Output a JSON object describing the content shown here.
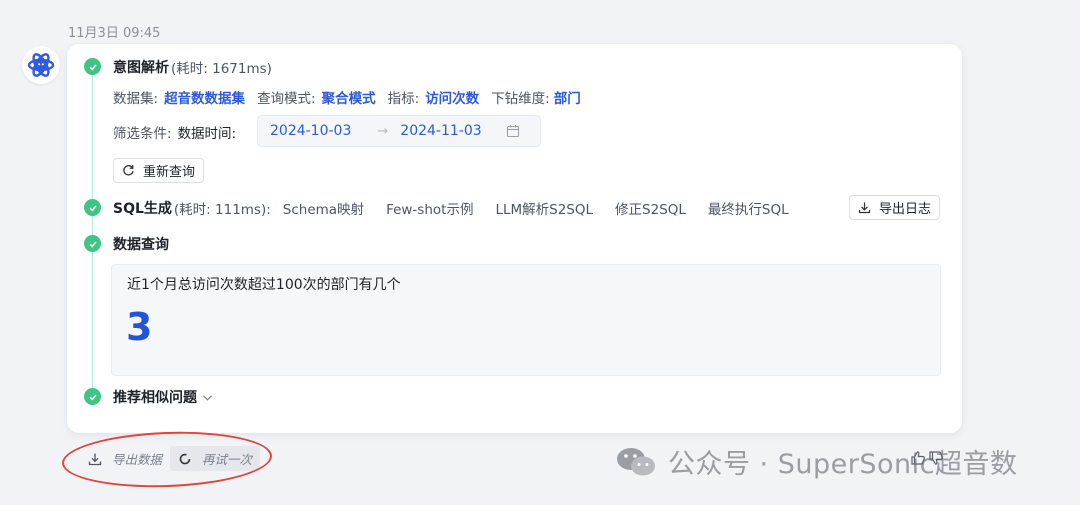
{
  "timestamp": "11月3日 09:45",
  "steps": {
    "intent": {
      "title": "意图解析",
      "elapsed": "(耗时: 1671ms)",
      "dataset_label": "数据集:",
      "dataset_value": "超音数数据集",
      "query_mode_label": "查询模式:",
      "query_mode_value": "聚合模式",
      "metric_label": "指标:",
      "metric_value": "访问次数",
      "drill_label": "下钻维度:",
      "drill_value": "部门",
      "filter_label": "筛选条件:",
      "date_label": "数据时间:",
      "date_start": "2024-10-03",
      "date_arrow": "→",
      "date_end": "2024-11-03",
      "requery_label": "重新查询"
    },
    "sql": {
      "title": "SQL生成",
      "elapsed": "(耗时: 111ms):",
      "items": [
        "Schema映射",
        "Few-shot示例",
        "LLM解析S2SQL",
        "修正S2SQL",
        "最终执行SQL"
      ],
      "export_log_label": "导出日志"
    },
    "query": {
      "title": "数据查询",
      "question": "近1个月总访问次数超过100次的部门有几个",
      "result": "3"
    },
    "recommend": {
      "title": "推荐相似问题"
    }
  },
  "actions": {
    "export_data_label": "导出数据",
    "retry_label": "再试一次"
  },
  "watermark": {
    "text": "公众号 · SuperSonic超音数"
  },
  "colors": {
    "accent": "#2d5bd8",
    "success": "#3ec483",
    "annotation": "#e0453a"
  }
}
